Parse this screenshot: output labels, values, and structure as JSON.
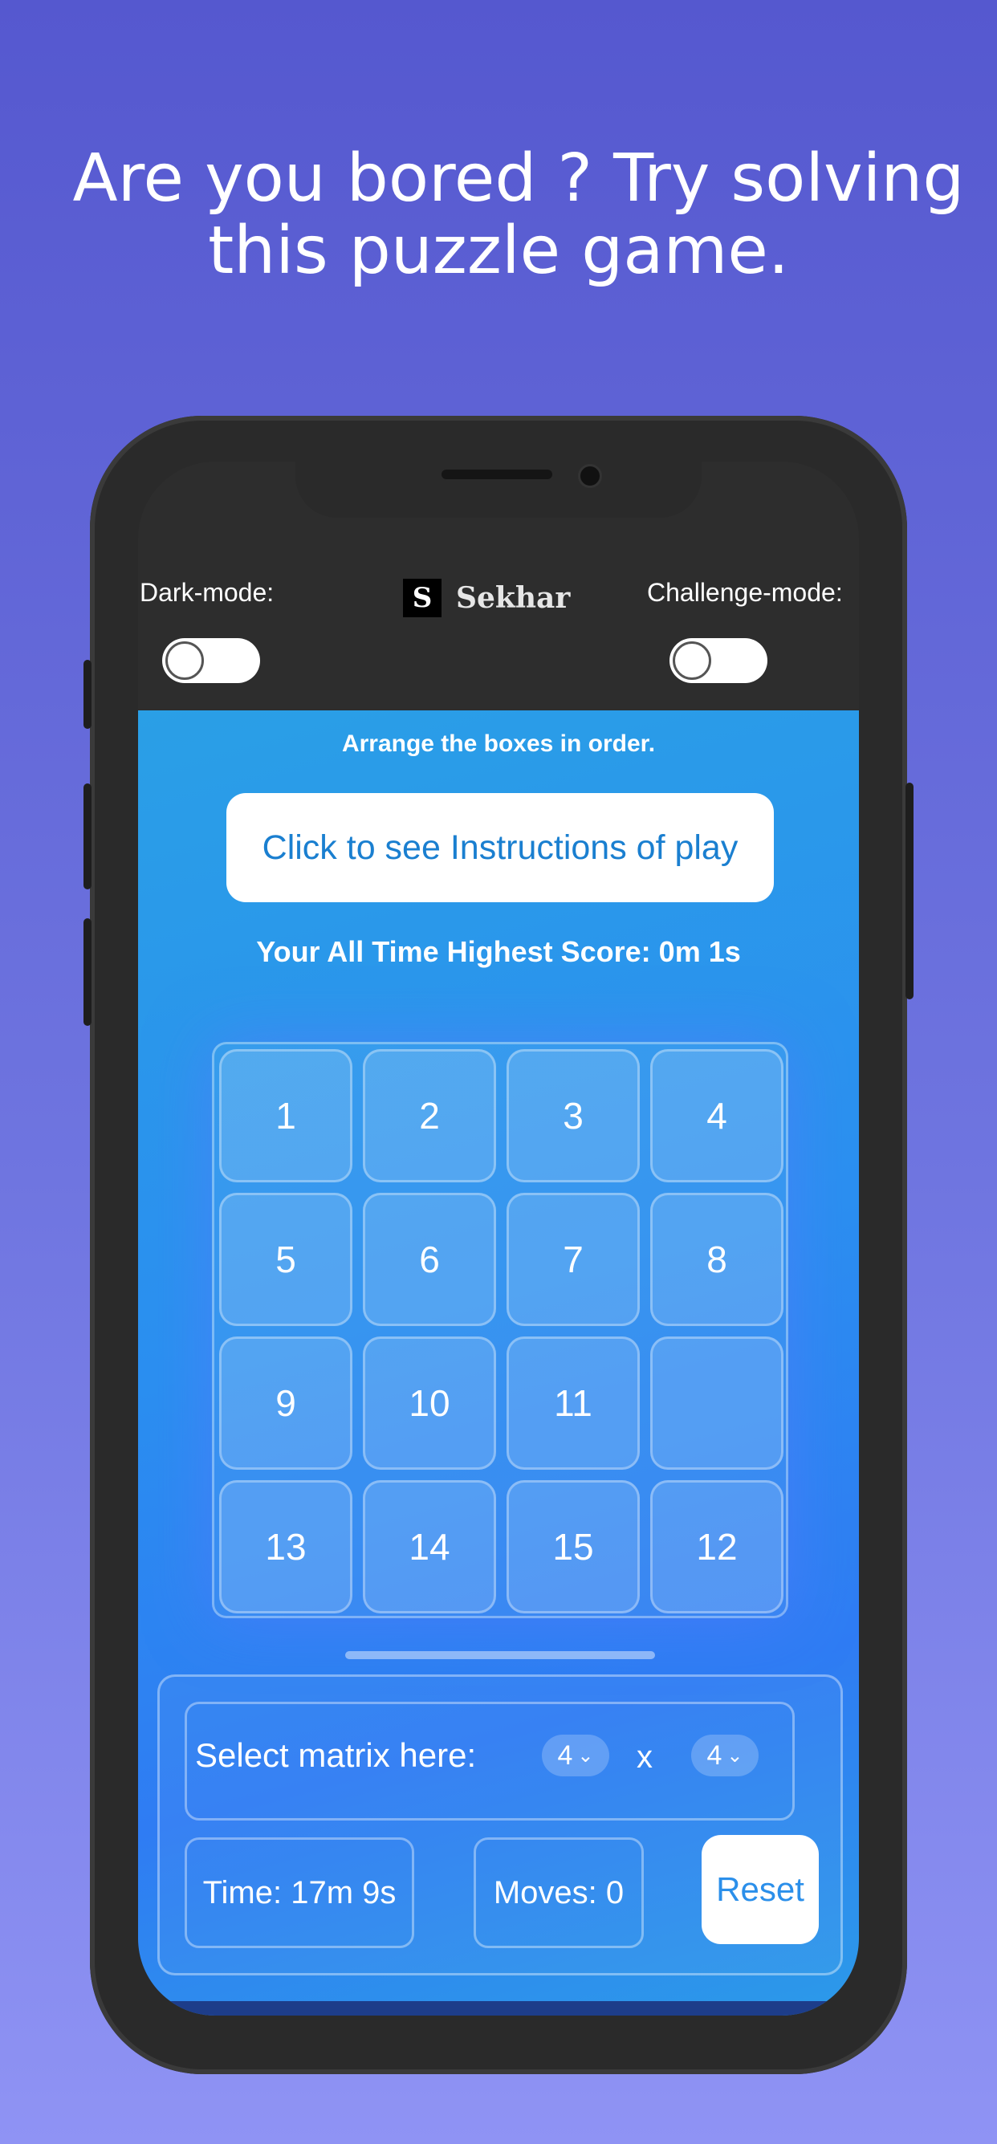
{
  "headline": {
    "line1": "Are you bored ? Try solving",
    "line2": "this puzzle game."
  },
  "topbar": {
    "dark_mode_label": "Dark-mode:",
    "challenge_mode_label": "Challenge-mode:",
    "dark_mode_on": false,
    "challenge_mode_on": false,
    "logo_mark": "S",
    "logo_name": "Sekhar"
  },
  "main": {
    "arrange_text": "Arrange the boxes in order.",
    "instructions_button": "Click to see Instructions of play",
    "highest_score": "Your All Time Highest Score: 0m 1s"
  },
  "board": {
    "tiles": [
      "1",
      "2",
      "3",
      "4",
      "5",
      "6",
      "7",
      "8",
      "9",
      "10",
      "11",
      "",
      "13",
      "14",
      "15",
      "12"
    ]
  },
  "controls": {
    "select_matrix_label": "Select matrix here:",
    "rows_value": "4",
    "cols_value": "4",
    "times_symbol": "x",
    "time_text": "Time: 17m 9s",
    "moves_text": "Moves: 0",
    "reset_label": "Reset"
  },
  "colors": {
    "background": "#5f63d8",
    "topbar": "#2d2d2d",
    "main_blue": "#2b8ff0",
    "accent_text": "#1a7fd0"
  }
}
